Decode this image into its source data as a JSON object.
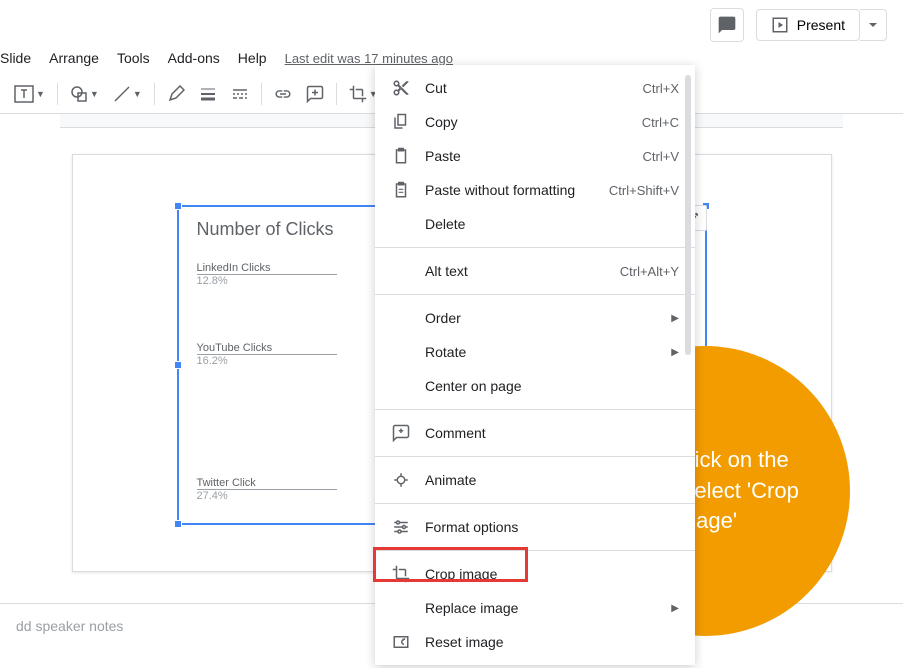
{
  "menubar": {
    "items": [
      "Slide",
      "Arrange",
      "Tools",
      "Add-ons",
      "Help"
    ],
    "last_edit": "Last edit was 17 minutes ago"
  },
  "topbar": {
    "present_label": "Present"
  },
  "chart_data": {
    "type": "pie",
    "title": "Number of Clicks",
    "series": [
      {
        "name": "LinkedIn Clicks",
        "value": 12.8
      },
      {
        "name": "YouTube Clicks",
        "value": 16.2
      },
      {
        "name": "Twitter Click",
        "value": 27.4
      }
    ]
  },
  "context_menu": {
    "items": [
      {
        "icon": "scissors-icon",
        "label": "Cut",
        "shortcut": "Ctrl+X"
      },
      {
        "icon": "copy-icon",
        "label": "Copy",
        "shortcut": "Ctrl+C"
      },
      {
        "icon": "clipboard-icon",
        "label": "Paste",
        "shortcut": "Ctrl+V"
      },
      {
        "icon": "clipboard-plain-icon",
        "label": "Paste without formatting",
        "shortcut": "Ctrl+Shift+V"
      },
      {
        "icon": "",
        "label": "Delete",
        "shortcut": ""
      },
      {
        "sep": true
      },
      {
        "icon": "",
        "label": "Alt text",
        "shortcut": "Ctrl+Alt+Y"
      },
      {
        "sep": true
      },
      {
        "icon": "",
        "label": "Order",
        "submenu": true
      },
      {
        "icon": "",
        "label": "Rotate",
        "submenu": true
      },
      {
        "icon": "",
        "label": "Center on page",
        "shortcut": ""
      },
      {
        "sep": true
      },
      {
        "icon": "comment-add-icon",
        "label": "Comment",
        "shortcut": ""
      },
      {
        "sep": true
      },
      {
        "icon": "motion-icon",
        "label": "Animate",
        "shortcut": ""
      },
      {
        "sep": true
      },
      {
        "icon": "tune-icon",
        "label": "Format options",
        "shortcut": ""
      },
      {
        "sep": true
      },
      {
        "icon": "crop-icon",
        "label": "Crop image",
        "shortcut": ""
      },
      {
        "icon": "",
        "label": "Replace image",
        "submenu": true
      },
      {
        "icon": "reset-image-icon",
        "label": "Reset image",
        "shortcut": ""
      }
    ]
  },
  "callout": {
    "text": "Right click on the image, select 'Crop image'"
  },
  "notes": {
    "placeholder": "dd speaker notes"
  }
}
